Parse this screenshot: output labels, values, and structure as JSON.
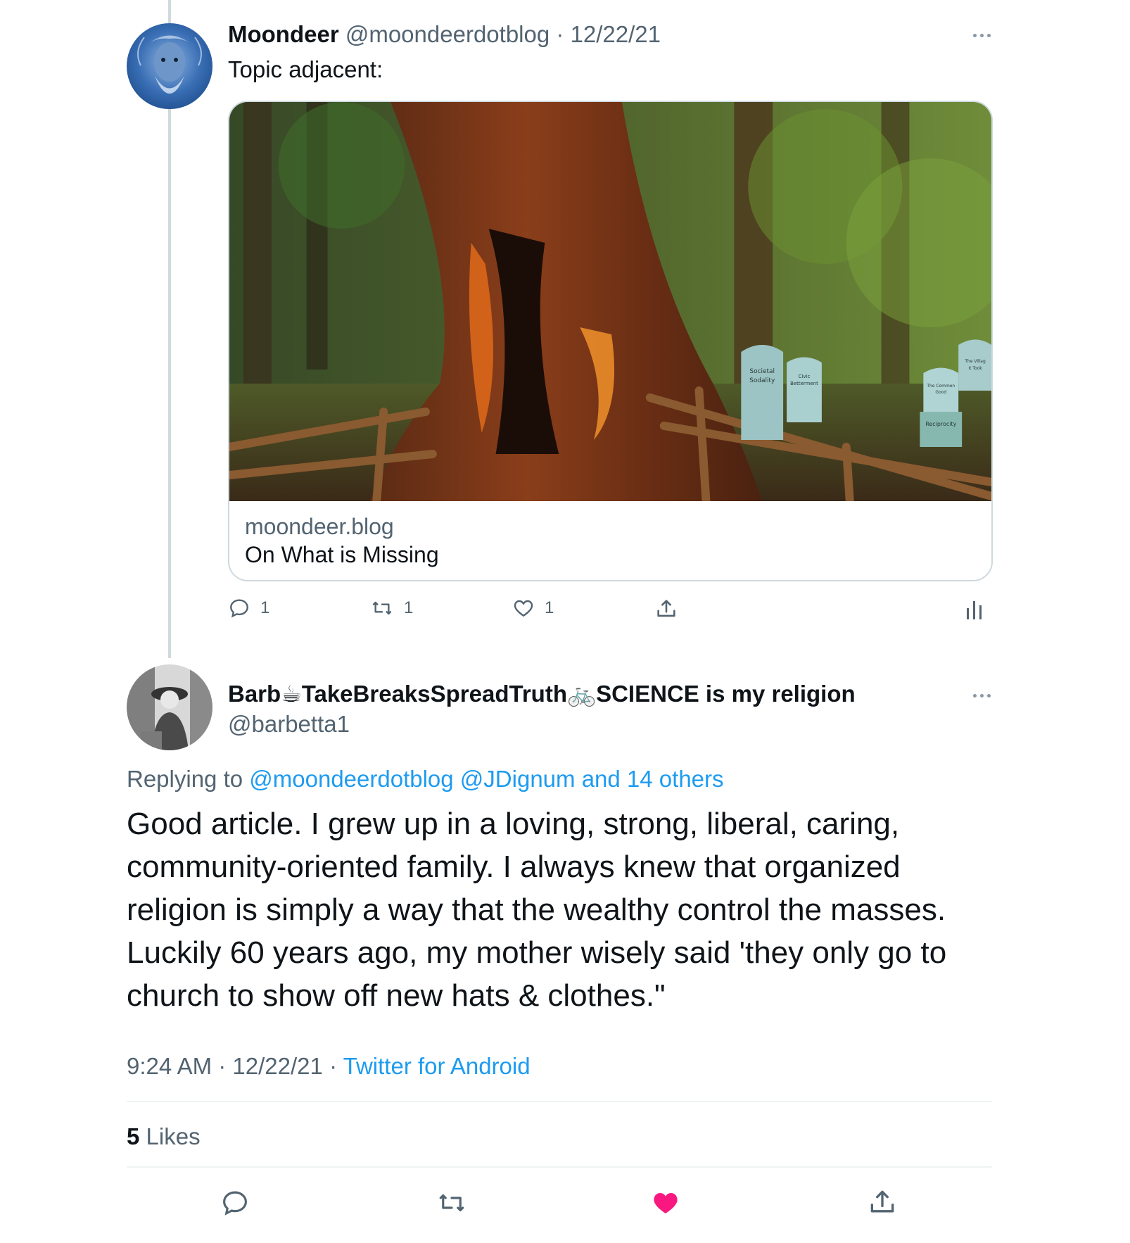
{
  "parent_tweet": {
    "display_name": "Moondeer",
    "handle": "@moondeerdotblog",
    "separator": "·",
    "date": "12/22/21",
    "text": "Topic adjacent:",
    "card": {
      "domain": "moondeer.blog",
      "title": "On What is Missing",
      "image_tombstones": [
        "Societal Sodality",
        "Civic Betterment",
        "The Common Good",
        "Reciprocity",
        "The Village It Took"
      ]
    },
    "actions": {
      "reply_count": "1",
      "retweet_count": "1",
      "like_count": "1"
    },
    "icons": [
      "more-icon",
      "reply-icon",
      "retweet-icon",
      "like-icon",
      "share-icon",
      "analytics-icon"
    ]
  },
  "reply_tweet": {
    "display_name": "Barb☕TakeBreaksSpreadTruth🚲SCIENCE is my religion",
    "handle": "@barbetta1",
    "replying_prefix": "Replying to",
    "replying_mentions": "@moondeerdotblog @JDignum and 14 others",
    "text": "Good article. I grew up in a loving, strong, liberal, caring, community-oriented family. I always knew that organized religion is simply a way that the wealthy control the masses. Luckily 60 years ago, my mother wisely said 'they only go to church to show off new hats & clothes.\"",
    "time": "9:24 AM",
    "separator": "·",
    "date": "12/22/21",
    "source": "Twitter for Android",
    "likes_count": "5",
    "likes_label": "Likes",
    "like_active_color": "#f91880"
  },
  "colors": {
    "link": "#1d9bf0",
    "muted": "#536471",
    "text": "#0f1419",
    "divider": "#eff3f4"
  }
}
